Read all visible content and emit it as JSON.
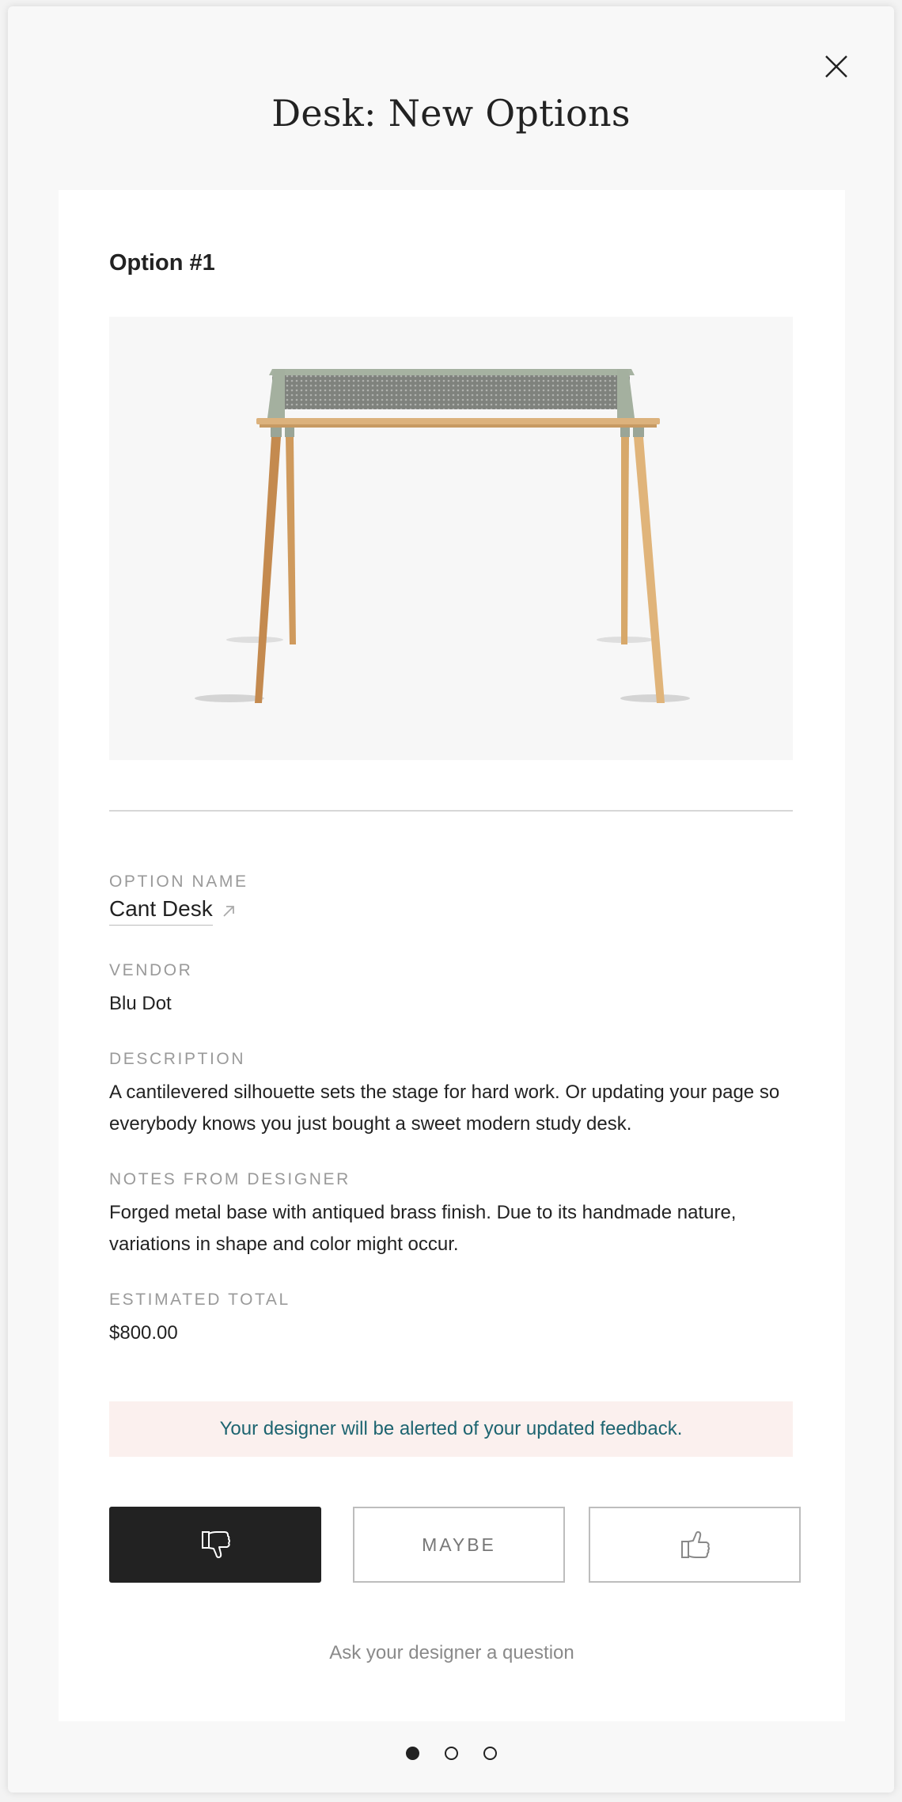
{
  "modal": {
    "title": "Desk: New Options",
    "close_icon": "close-icon"
  },
  "option": {
    "heading": "Option #1",
    "image_alt": "Cant Desk product photo",
    "fields": {
      "name_label": "OPTION NAME",
      "name_value": "Cant Desk",
      "vendor_label": "VENDOR",
      "vendor_value": "Blu Dot",
      "description_label": "DESCRIPTION",
      "description_value": "A cantilevered silhouette sets the stage for hard work. Or updating your page so everybody knows you just bought a sweet modern study desk.",
      "notes_label": "NOTES FROM DESIGNER",
      "notes_value": "Forged metal base with antiqued brass finish. Due to its handmade nature, variations in shape and color might occur.",
      "total_label": "ESTIMATED TOTAL",
      "total_value": "$800.00"
    },
    "alert_text": "Your designer will be alerted of your updated feedback.",
    "feedback": {
      "dislike_icon": "thumbs-down-icon",
      "maybe_label": "MAYBE",
      "like_icon": "thumbs-up-icon",
      "selected": "dislike"
    },
    "ask_link": "Ask your designer a question"
  },
  "pagination": {
    "total": 3,
    "current": 1
  },
  "colors": {
    "alert_bg": "#fbf0ee",
    "alert_text": "#1d6470",
    "selected_button": "#222222"
  }
}
